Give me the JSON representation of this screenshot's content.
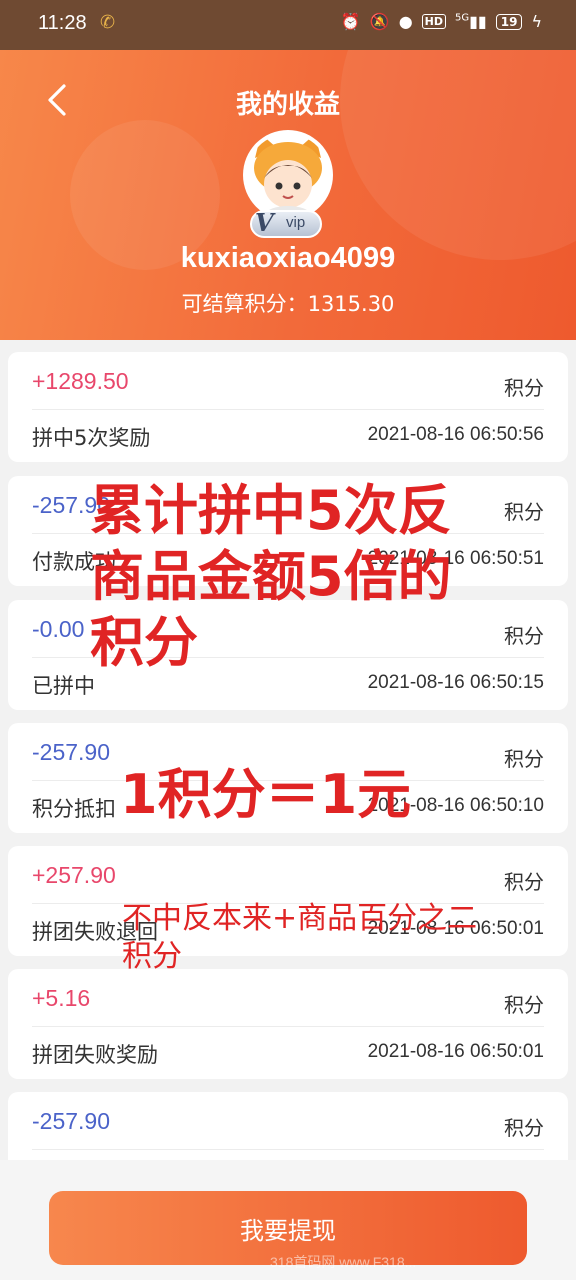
{
  "status_bar": {
    "time": "11:28",
    "icons": [
      "alarm-icon",
      "mute-icon",
      "mic-icon",
      "hd-icon",
      "signal-5g-icon",
      "battery-icon"
    ],
    "hd_label": "HD",
    "network_label": "5G",
    "battery_level": "19"
  },
  "header": {
    "title": "我的收益",
    "username": "kuxiaoxiao4099",
    "vip_label": "vip",
    "points_label": "可结算积分：",
    "points_value": "1315.30",
    "accent_color": "#f26a3a"
  },
  "records": [
    {
      "amount": "+1289.50",
      "sign": "pos",
      "unit": "积分",
      "desc": "拼中5次奖励",
      "time": "2021-08-16 06:50:56"
    },
    {
      "amount": "-257.90",
      "sign": "neg",
      "unit": "积分",
      "desc": "付款成功",
      "time": "2021-08-16 06:50:51"
    },
    {
      "amount": "-0.00",
      "sign": "neg",
      "unit": "积分",
      "desc": "已拼中",
      "time": "2021-08-16 06:50:15"
    },
    {
      "amount": "-257.90",
      "sign": "neg",
      "unit": "积分",
      "desc": "积分抵扣",
      "time": "2021-08-16 06:50:10"
    },
    {
      "amount": "+257.90",
      "sign": "pos",
      "unit": "积分",
      "desc": "拼团失败退回",
      "time": "2021-08-16 06:50:01"
    },
    {
      "amount": "+5.16",
      "sign": "pos",
      "unit": "积分",
      "desc": "拼团失败奖励",
      "time": "2021-08-16 06:50:01"
    },
    {
      "amount": "-257.90",
      "sign": "neg",
      "unit": "积分",
      "desc": "",
      "time": ""
    }
  ],
  "overlay": {
    "line1": "累计拼中5次反",
    "line2": "商品金额5倍的",
    "line3": "积分",
    "line4": "1积分＝1元",
    "line5": "不中反本来+商品百分之二",
    "line6": "积分"
  },
  "footer": {
    "withdraw_label": "我要提现",
    "watermark": "318首码网 www.F318..."
  }
}
